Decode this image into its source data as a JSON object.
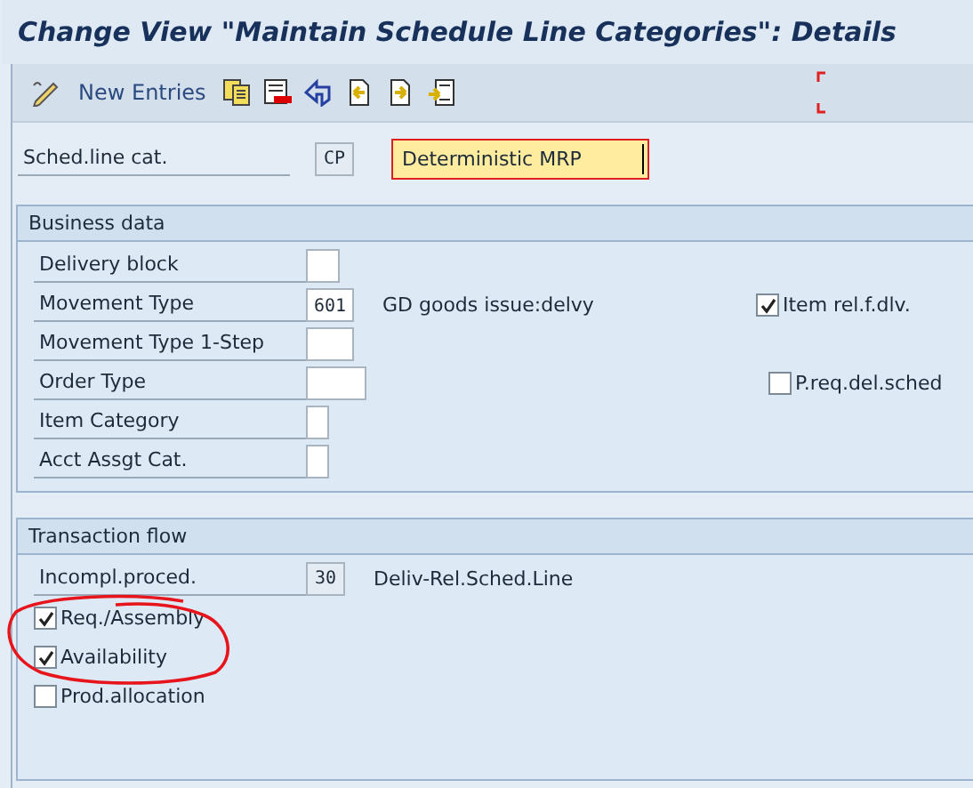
{
  "window": {
    "title": "Change View \"Maintain Schedule Line Categories\": Details"
  },
  "toolbar": {
    "new_entries": "New Entries"
  },
  "header_field": {
    "label": "Sched.line cat.",
    "value": "CP",
    "description": "Deterministic MRP"
  },
  "business_data": {
    "title": "Business data",
    "rows": [
      {
        "label": "Delivery block",
        "value": ""
      },
      {
        "label": "Movement Type",
        "value": "601",
        "description": "GD goods issue:delvy",
        "checkbox": {
          "label": "Item rel.f.dlv.",
          "checked": true
        }
      },
      {
        "label": "Movement Type 1-Step",
        "value": ""
      },
      {
        "label": "Order Type",
        "value": "",
        "checkbox": {
          "label": "P.req.del.sched",
          "checked": false
        }
      },
      {
        "label": "Item Category",
        "value": ""
      },
      {
        "label": "Acct Assgt Cat.",
        "value": ""
      }
    ]
  },
  "transaction_flow": {
    "title": "Transaction flow",
    "rows": [
      {
        "kind": "field",
        "label": "Incompl.proced.",
        "value": "30",
        "description": "Deliv-Rel.Sched.Line"
      },
      {
        "kind": "checkbox",
        "label": "Req./Assembly",
        "checked": true
      },
      {
        "kind": "checkbox",
        "label": "Availability",
        "checked": true
      },
      {
        "kind": "checkbox",
        "label": "Prod.allocation",
        "checked": false
      }
    ]
  }
}
